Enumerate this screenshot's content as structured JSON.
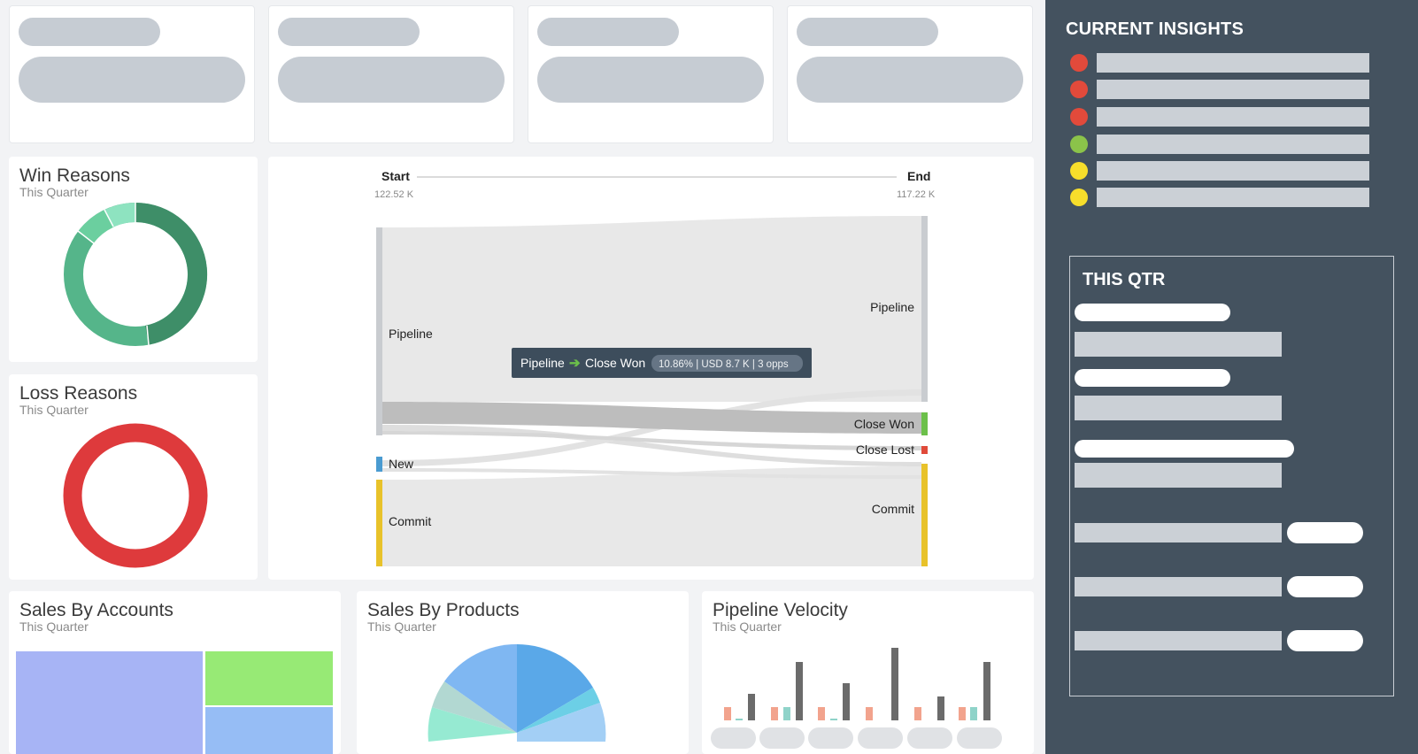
{
  "win_reasons": {
    "title": "Win Reasons",
    "subtitle": "This Quarter"
  },
  "loss_reasons": {
    "title": "Loss Reasons",
    "subtitle": "This Quarter"
  },
  "sankey": {
    "start_label": "Start",
    "start_value": "122.52 K",
    "end_label": "End",
    "end_value": "117.22 K",
    "left_nodes": {
      "pipeline": "Pipeline",
      "new": "New",
      "commit": "Commit"
    },
    "right_nodes": {
      "pipeline": "Pipeline",
      "close_won": "Close Won",
      "close_lost": "Close Lost",
      "commit": "Commit"
    },
    "tooltip": {
      "from": "Pipeline",
      "to": "Close Won",
      "detail": "10.86% | USD 8.7 K | 3 opps"
    },
    "colors": {
      "pipeline": "#c9ccd0",
      "new": "#4a9bd1",
      "commit": "#e8c22a",
      "close_won": "#6cc04a",
      "close_lost": "#e04a3a"
    }
  },
  "sales_by_accounts": {
    "title": "Sales By Accounts",
    "subtitle": "This Quarter"
  },
  "sales_by_products": {
    "title": "Sales By Products",
    "subtitle": "This Quarter"
  },
  "pipeline_velocity": {
    "title": "Pipeline Velocity",
    "subtitle": "This Quarter"
  },
  "insights": {
    "title": "CURRENT INSIGHTS",
    "status_colors": [
      "#e24a3b",
      "#e24a3b",
      "#e24a3b",
      "#8bc34a",
      "#f7de2b",
      "#f7de2b"
    ]
  },
  "this_qtr": {
    "title": "THIS QTR"
  },
  "colors": {
    "sidebar": "#44525f",
    "placeholder": "#c6ccd3",
    "win_dark": "#3e8e68",
    "win_mid": "#55b58a",
    "win_light": "#7ed9b4",
    "loss": "#de3a3c"
  }
}
